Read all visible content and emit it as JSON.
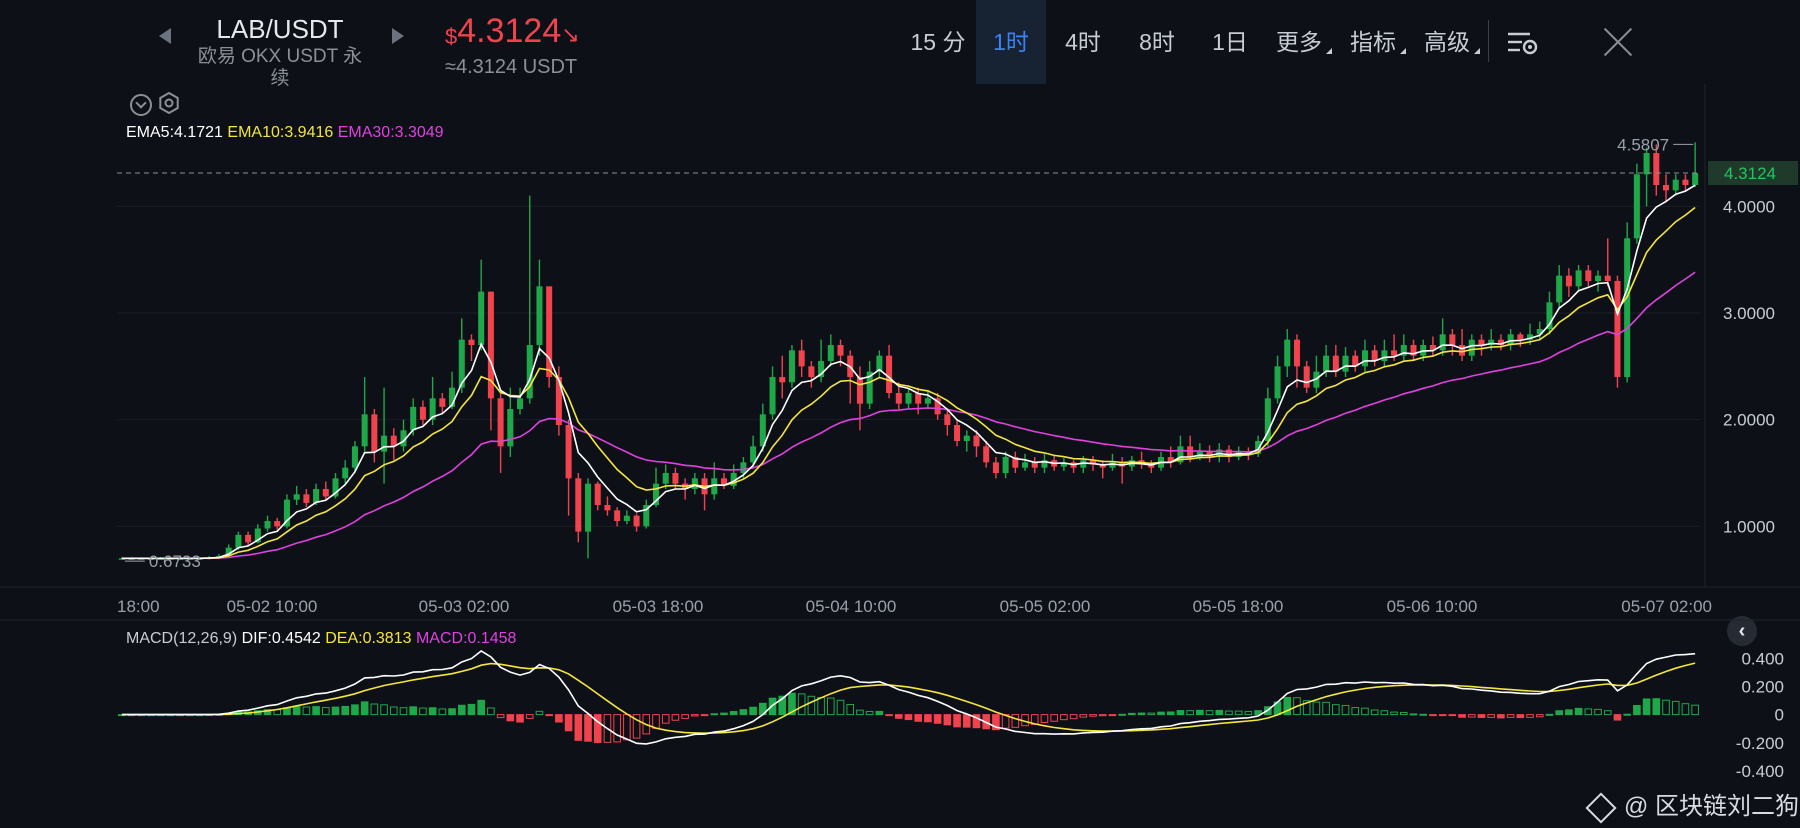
{
  "header": {
    "pair": "LAB/USDT",
    "exchange": "欧易 OKX USDT 永续",
    "currency_symbol": "$",
    "price": "4.3124",
    "price_direction_icon": "arrow-down-right-icon",
    "price_usd": "≈4.3124 USDT"
  },
  "toolbar": {
    "intervals": [
      "15 分",
      "1时",
      "4时",
      "8时",
      "1日"
    ],
    "active_interval": "1时",
    "more_label": "更多",
    "indicators_label": "指标",
    "advanced_label": "高级"
  },
  "ema_legend": {
    "ema5": "EMA5:4.1721",
    "ema10": "EMA10:3.9416",
    "ema30": "EMA30:3.3049"
  },
  "macd_legend": {
    "title": "MACD(12,26,9)",
    "dif": "DIF:0.4542",
    "dea": "DEA:0.3813",
    "macd": "MACD:0.1458"
  },
  "colors": {
    "up": "#1fa84a",
    "down": "#f0434d",
    "ema5": "#ffffff",
    "ema10": "#f5e63d",
    "ema30": "#e040e0",
    "current_price_bg": "#1f3a2a",
    "current_price_text": "#22c55e"
  },
  "watermark": "@ 区块链刘二狗",
  "chart_data": {
    "type": "candlestick",
    "price_axis": {
      "ticks": [
        "4.0000",
        "3.0000",
        "2.0000",
        "1.0000"
      ],
      "tick_values": [
        4,
        3,
        2,
        1
      ],
      "range": [
        0.45,
        4.95
      ]
    },
    "time_axis": {
      "labels": [
        "18:00",
        "05-02 10:00",
        "05-03 02:00",
        "05-03 18:00",
        "05-04 10:00",
        "05-05 02:00",
        "05-05 18:00",
        "05-06 10:00",
        "05-07 02:00"
      ]
    },
    "current_price": {
      "value": 4.3124,
      "label": "4.3124"
    },
    "high_marker": {
      "value": 4.5807,
      "label": "4.5807"
    },
    "low_marker": {
      "value": 0.6733,
      "label": "0.6733"
    },
    "macd_axis": {
      "ticks": [
        "0.400",
        "0.200",
        "0",
        "-0.200",
        "-0.400"
      ],
      "tick_values": [
        0.4,
        0.2,
        0,
        -0.2,
        -0.4
      ],
      "range": [
        -0.5,
        0.53
      ]
    },
    "candles": [
      [
        0.7,
        0.7,
        0.71,
        0.69
      ],
      [
        0.7,
        0.7,
        0.71,
        0.69
      ],
      [
        0.7,
        0.7,
        0.71,
        0.69
      ],
      [
        0.7,
        0.7,
        0.71,
        0.69
      ],
      [
        0.7,
        0.7,
        0.71,
        0.69
      ],
      [
        0.7,
        0.7,
        0.71,
        0.69
      ],
      [
        0.7,
        0.7,
        0.71,
        0.69
      ],
      [
        0.7,
        0.7,
        0.71,
        0.69
      ],
      [
        0.7,
        0.7,
        0.71,
        0.69
      ],
      [
        0.7,
        0.71,
        0.72,
        0.69
      ],
      [
        0.71,
        0.72,
        0.74,
        0.7
      ],
      [
        0.72,
        0.8,
        0.83,
        0.71
      ],
      [
        0.8,
        0.92,
        0.95,
        0.78
      ],
      [
        0.92,
        0.85,
        0.95,
        0.82
      ],
      [
        0.85,
        0.98,
        1.02,
        0.84
      ],
      [
        0.98,
        1.05,
        1.1,
        0.95
      ],
      [
        1.05,
        1.0,
        1.08,
        0.97
      ],
      [
        1.0,
        1.25,
        1.3,
        0.98
      ],
      [
        1.25,
        1.3,
        1.38,
        1.2
      ],
      [
        1.3,
        1.22,
        1.35,
        1.18
      ],
      [
        1.22,
        1.35,
        1.4,
        1.2
      ],
      [
        1.35,
        1.28,
        1.42,
        1.25
      ],
      [
        1.28,
        1.45,
        1.5,
        1.26
      ],
      [
        1.45,
        1.55,
        1.62,
        1.4
      ],
      [
        1.55,
        1.75,
        1.8,
        1.5
      ],
      [
        1.75,
        2.05,
        2.4,
        1.7
      ],
      [
        2.05,
        1.7,
        2.1,
        1.6
      ],
      [
        1.7,
        1.85,
        2.3,
        1.4
      ],
      [
        1.85,
        1.75,
        1.92,
        1.62
      ],
      [
        1.75,
        1.9,
        2.0,
        1.7
      ],
      [
        1.9,
        2.12,
        2.2,
        1.85
      ],
      [
        2.12,
        2.0,
        2.18,
        1.95
      ],
      [
        2.0,
        2.2,
        2.4,
        1.95
      ],
      [
        2.2,
        2.12,
        2.25,
        2.05
      ],
      [
        2.12,
        2.3,
        2.45,
        2.1
      ],
      [
        2.3,
        2.75,
        2.95,
        2.25
      ],
      [
        2.75,
        2.7,
        2.8,
        2.55
      ],
      [
        2.7,
        3.2,
        3.5,
        2.65
      ],
      [
        3.2,
        2.2,
        3.2,
        1.9
      ],
      [
        2.2,
        1.75,
        2.25,
        1.5
      ],
      [
        1.75,
        2.1,
        2.3,
        1.65
      ],
      [
        2.1,
        2.2,
        2.3,
        2.05
      ],
      [
        2.2,
        2.7,
        4.1,
        2.15
      ],
      [
        2.7,
        3.25,
        3.5,
        2.6
      ],
      [
        3.25,
        2.4,
        3.25,
        2.3
      ],
      [
        2.4,
        1.95,
        2.5,
        1.85
      ],
      [
        1.95,
        1.45,
        2.0,
        1.1
      ],
      [
        1.45,
        0.95,
        1.5,
        0.85
      ],
      [
        0.95,
        1.4,
        1.45,
        0.7
      ],
      [
        1.4,
        1.2,
        1.42,
        1.15
      ],
      [
        1.2,
        1.15,
        1.28,
        1.1
      ],
      [
        1.15,
        1.05,
        1.18,
        1.0
      ],
      [
        1.05,
        1.1,
        1.15,
        1.02
      ],
      [
        1.1,
        1.0,
        1.12,
        0.95
      ],
      [
        1.0,
        1.2,
        1.25,
        0.98
      ],
      [
        1.2,
        1.4,
        1.55,
        1.18
      ],
      [
        1.4,
        1.5,
        1.58,
        1.35
      ],
      [
        1.5,
        1.4,
        1.55,
        1.35
      ],
      [
        1.4,
        1.35,
        1.45,
        1.25
      ],
      [
        1.35,
        1.45,
        1.5,
        1.3
      ],
      [
        1.45,
        1.3,
        1.5,
        1.15
      ],
      [
        1.3,
        1.45,
        1.6,
        1.25
      ],
      [
        1.45,
        1.38,
        1.5,
        1.35
      ],
      [
        1.38,
        1.5,
        1.58,
        1.35
      ],
      [
        1.5,
        1.6,
        1.65,
        1.45
      ],
      [
        1.6,
        1.75,
        1.85,
        1.55
      ],
      [
        1.75,
        2.05,
        2.15,
        1.7
      ],
      [
        2.05,
        2.4,
        2.5,
        2.0
      ],
      [
        2.4,
        2.35,
        2.6,
        2.2
      ],
      [
        2.35,
        2.65,
        2.7,
        2.3
      ],
      [
        2.65,
        2.5,
        2.75,
        2.4
      ],
      [
        2.5,
        2.4,
        2.55,
        2.3
      ],
      [
        2.4,
        2.55,
        2.75,
        2.35
      ],
      [
        2.55,
        2.7,
        2.8,
        2.5
      ],
      [
        2.7,
        2.6,
        2.75,
        2.5
      ],
      [
        2.6,
        2.4,
        2.65,
        2.15
      ],
      [
        2.4,
        2.15,
        2.5,
        1.9
      ],
      [
        2.15,
        2.45,
        2.55,
        2.1
      ],
      [
        2.45,
        2.6,
        2.65,
        2.4
      ],
      [
        2.6,
        2.25,
        2.7,
        2.2
      ],
      [
        2.25,
        2.15,
        2.35,
        2.1
      ],
      [
        2.15,
        2.25,
        2.3,
        2.1
      ],
      [
        2.25,
        2.15,
        2.3,
        2.05
      ],
      [
        2.15,
        2.2,
        2.28,
        2.1
      ],
      [
        2.2,
        2.05,
        2.25,
        2.0
      ],
      [
        2.05,
        1.95,
        2.1,
        1.85
      ],
      [
        1.95,
        1.8,
        2.0,
        1.75
      ],
      [
        1.8,
        1.85,
        1.9,
        1.7
      ],
      [
        1.85,
        1.75,
        1.9,
        1.65
      ],
      [
        1.75,
        1.6,
        1.8,
        1.55
      ],
      [
        1.6,
        1.5,
        1.65,
        1.45
      ],
      [
        1.5,
        1.65,
        1.7,
        1.45
      ],
      [
        1.65,
        1.55,
        1.7,
        1.5
      ],
      [
        1.55,
        1.6,
        1.68,
        1.52
      ],
      [
        1.6,
        1.55,
        1.65,
        1.5
      ],
      [
        1.55,
        1.62,
        1.68,
        1.5
      ],
      [
        1.62,
        1.56,
        1.66,
        1.52
      ],
      [
        1.56,
        1.6,
        1.64,
        1.52
      ],
      [
        1.6,
        1.55,
        1.62,
        1.5
      ],
      [
        1.55,
        1.62,
        1.66,
        1.5
      ],
      [
        1.62,
        1.58,
        1.66,
        1.52
      ],
      [
        1.58,
        1.55,
        1.62,
        1.45
      ],
      [
        1.55,
        1.6,
        1.68,
        1.52
      ],
      [
        1.6,
        1.56,
        1.65,
        1.4
      ],
      [
        1.56,
        1.62,
        1.66,
        1.52
      ],
      [
        1.62,
        1.58,
        1.7,
        1.54
      ],
      [
        1.58,
        1.55,
        1.62,
        1.5
      ],
      [
        1.55,
        1.65,
        1.7,
        1.52
      ],
      [
        1.65,
        1.6,
        1.75,
        1.55
      ],
      [
        1.6,
        1.75,
        1.85,
        1.58
      ],
      [
        1.75,
        1.65,
        1.85,
        1.6
      ],
      [
        1.65,
        1.7,
        1.78,
        1.62
      ],
      [
        1.7,
        1.66,
        1.76,
        1.6
      ],
      [
        1.66,
        1.72,
        1.78,
        1.6
      ],
      [
        1.72,
        1.65,
        1.76,
        1.6
      ],
      [
        1.65,
        1.7,
        1.75,
        1.62
      ],
      [
        1.7,
        1.68,
        1.74,
        1.62
      ],
      [
        1.68,
        1.8,
        1.85,
        1.65
      ],
      [
        1.8,
        2.2,
        2.3,
        1.75
      ],
      [
        2.2,
        2.5,
        2.6,
        2.15
      ],
      [
        2.5,
        2.75,
        2.85,
        2.4
      ],
      [
        2.75,
        2.5,
        2.8,
        2.3
      ],
      [
        2.5,
        2.3,
        2.55,
        2.25
      ],
      [
        2.3,
        2.45,
        2.6,
        2.25
      ],
      [
        2.45,
        2.6,
        2.7,
        2.4
      ],
      [
        2.6,
        2.45,
        2.7,
        2.4
      ],
      [
        2.45,
        2.6,
        2.68,
        2.4
      ],
      [
        2.6,
        2.5,
        2.65,
        2.45
      ],
      [
        2.5,
        2.65,
        2.75,
        2.45
      ],
      [
        2.65,
        2.55,
        2.7,
        2.5
      ],
      [
        2.55,
        2.65,
        2.75,
        2.5
      ],
      [
        2.65,
        2.6,
        2.8,
        2.55
      ],
      [
        2.6,
        2.7,
        2.8,
        2.55
      ],
      [
        2.7,
        2.6,
        2.75,
        2.55
      ],
      [
        2.6,
        2.7,
        2.75,
        2.55
      ],
      [
        2.7,
        2.65,
        2.78,
        2.6
      ],
      [
        2.65,
        2.8,
        2.95,
        2.6
      ],
      [
        2.8,
        2.7,
        2.85,
        2.6
      ],
      [
        2.7,
        2.6,
        2.85,
        2.55
      ],
      [
        2.6,
        2.75,
        2.8,
        2.55
      ],
      [
        2.75,
        2.7,
        2.8,
        2.6
      ],
      [
        2.7,
        2.75,
        2.85,
        2.65
      ],
      [
        2.75,
        2.7,
        2.8,
        2.65
      ],
      [
        2.7,
        2.8,
        2.85,
        2.65
      ],
      [
        2.8,
        2.75,
        2.82,
        2.68
      ],
      [
        2.75,
        2.8,
        2.9,
        2.7
      ],
      [
        2.8,
        2.85,
        2.92,
        2.75
      ],
      [
        2.85,
        3.1,
        3.2,
        2.8
      ],
      [
        3.1,
        3.35,
        3.45,
        3.05
      ],
      [
        3.35,
        3.25,
        3.42,
        3.15
      ],
      [
        3.25,
        3.4,
        3.45,
        3.2
      ],
      [
        3.4,
        3.3,
        3.45,
        3.25
      ],
      [
        3.3,
        3.35,
        3.4,
        3.2
      ],
      [
        3.35,
        3.3,
        3.7,
        3.25
      ],
      [
        3.3,
        2.4,
        3.35,
        2.3
      ],
      [
        2.4,
        3.7,
        3.85,
        2.35
      ],
      [
        3.7,
        4.3,
        4.4,
        3.65
      ],
      [
        4.3,
        4.5,
        4.55,
        4.0
      ],
      [
        4.5,
        4.2,
        4.58,
        4.1
      ],
      [
        4.2,
        4.15,
        4.3,
        4.05
      ],
      [
        4.15,
        4.25,
        4.3,
        4.1
      ],
      [
        4.25,
        4.2,
        4.3,
        4.15
      ],
      [
        4.2,
        4.31,
        4.6,
        4.18
      ]
    ],
    "series": [
      {
        "name": "EMA5",
        "value": 4.1721
      },
      {
        "name": "EMA10",
        "value": 3.9416
      },
      {
        "name": "EMA30",
        "value": 3.3049
      }
    ],
    "macd_values": {
      "dif": 0.4542,
      "dea": 0.3813,
      "macd": 0.1458
    }
  }
}
